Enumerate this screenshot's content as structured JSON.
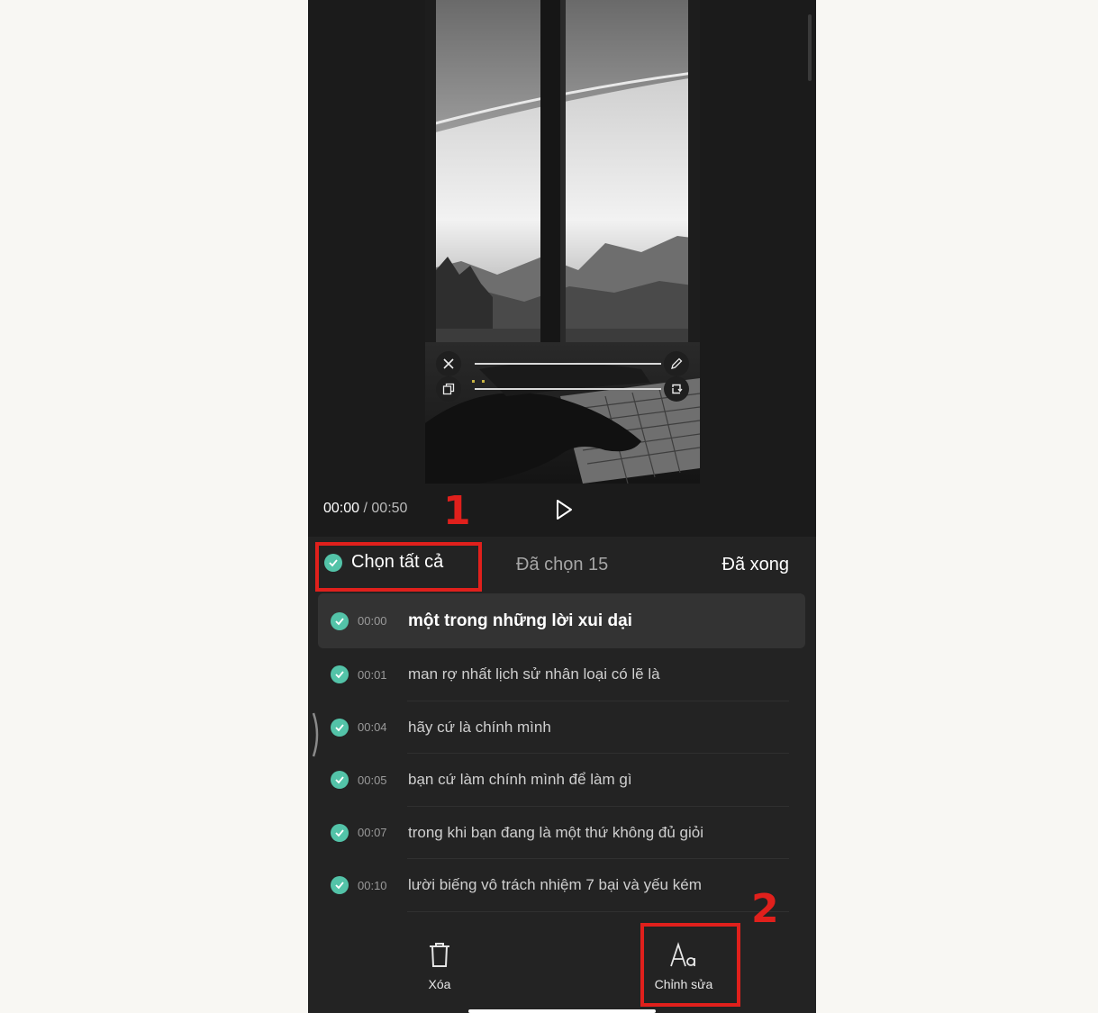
{
  "player": {
    "current_time": "00:00",
    "separator": "/",
    "duration": "00:50"
  },
  "annotations": {
    "step1": "1",
    "step2": "2"
  },
  "header": {
    "select_all_label": "Chọn tất cả",
    "selected_count_label": "Đã chọn 15",
    "done_label": "Đã xong"
  },
  "subtitles": [
    {
      "time": "00:00",
      "text": "một trong những lời xui dại",
      "selected": true,
      "active": true
    },
    {
      "time": "00:01",
      "text": "man rợ nhất lịch sử nhân loại có lẽ là",
      "selected": true,
      "active": false
    },
    {
      "time": "00:04",
      "text": "hãy cứ là chính mình",
      "selected": true,
      "active": false
    },
    {
      "time": "00:05",
      "text": "bạn cứ làm chính mình để làm gì",
      "selected": true,
      "active": false
    },
    {
      "time": "00:07",
      "text": "trong khi bạn đang là một thứ không đủ giỏi",
      "selected": true,
      "active": false
    },
    {
      "time": "00:10",
      "text": "lười biếng vô trách nhiệm 7 bại và yếu kém",
      "selected": true,
      "active": false
    }
  ],
  "toolbar": {
    "delete_label": "Xóa",
    "edit_label": "Chỉnh sửa"
  },
  "colors": {
    "accent_check": "#53c3a8",
    "annotation_red": "#e0201c",
    "background": "#1b1b1b"
  },
  "icons": [
    "close-icon",
    "pencil-icon",
    "copy-icon",
    "rotate-icon",
    "play-icon",
    "check-icon",
    "trash-icon",
    "text-style-icon"
  ]
}
